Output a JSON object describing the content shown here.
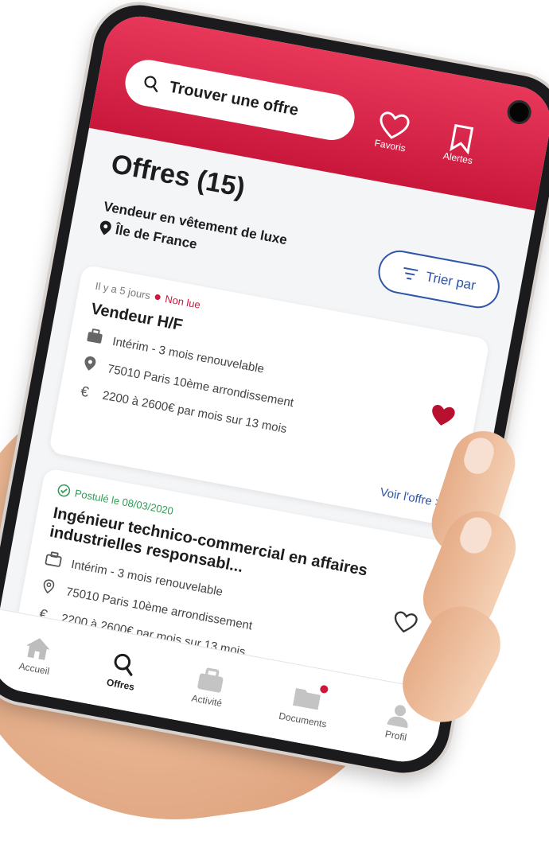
{
  "header": {
    "search_placeholder": "Trouver une offre",
    "favorites_label": "Favoris",
    "alerts_label": "Alertes"
  },
  "listing": {
    "title": "Offres (15)",
    "criteria_job": "Vendeur en vêtement de luxe",
    "criteria_location": "Île de France",
    "sort_label": "Trier par"
  },
  "cards": [
    {
      "posted": "Il y a 5 jours",
      "status": "Non lue",
      "title": "Vendeur H/F",
      "contract": "Intérim - 3 mois renouvelable",
      "location": "75010 Paris 10ème arrondissement",
      "salary": "2200 à 2600€ par mois sur 13 mois",
      "link": "Voir l'offre >"
    },
    {
      "applied": "Postulé le 08/03/2020",
      "title": "Ingénieur technico-commercial en affaires industrielles responsabl...",
      "contract": "Intérim - 3 mois renouvelable",
      "location": "75010 Paris 10ème arrondissement",
      "salary": "2200 à 2600€ par mois sur 13 mois"
    }
  ],
  "nav": {
    "home": "Accueil",
    "offers": "Offres",
    "activity": "Activité",
    "documents": "Documents",
    "profile": "Profil"
  },
  "colors": {
    "brand_red": "#d0173a",
    "link_blue": "#2f56a8",
    "success_green": "#2f9e55"
  }
}
